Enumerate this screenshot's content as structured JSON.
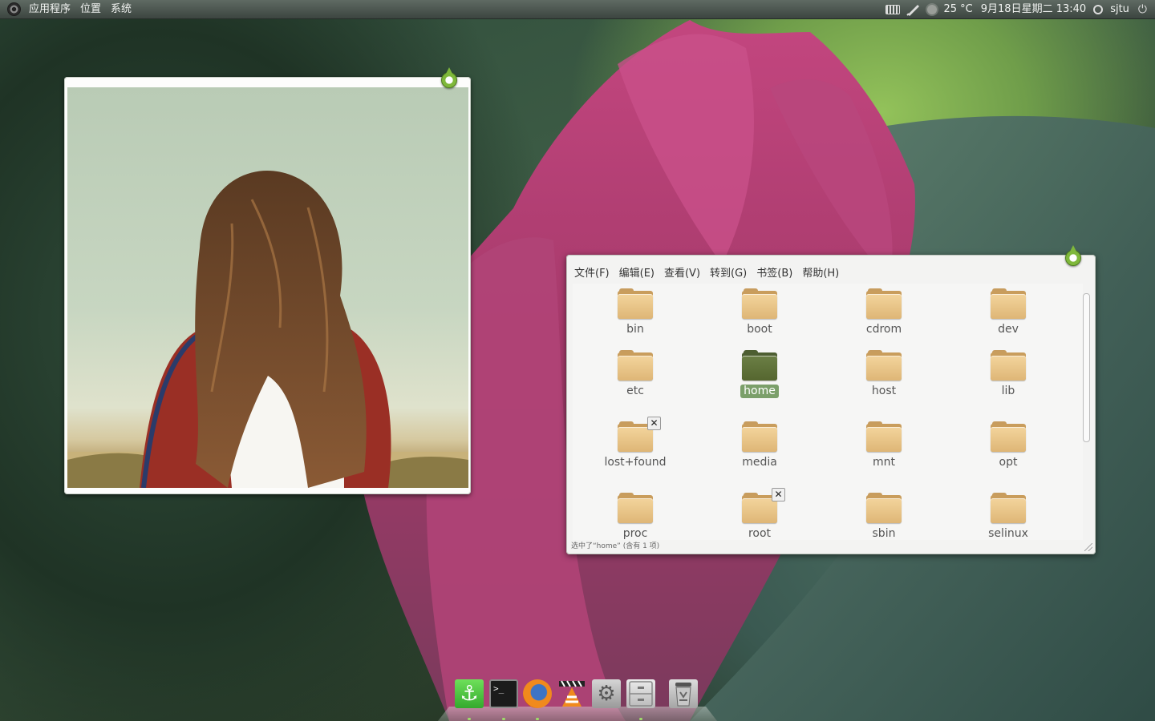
{
  "top_panel": {
    "menus": [
      "应用程序",
      "位置",
      "系统"
    ],
    "temperature": "25 °C",
    "datetime": "9月18日星期二 13:40",
    "username": "sjtu",
    "icons": [
      "ubuntu-logo-icon",
      "keyboard-icon",
      "network-icon",
      "weather-icon",
      "user-icon",
      "power-icon"
    ]
  },
  "photo_widget": {
    "icons": [
      "pin-icon"
    ]
  },
  "file_manager": {
    "menu": [
      "文件(F)",
      "编辑(E)",
      "查看(V)",
      "转到(G)",
      "书签(B)",
      "帮助(H)"
    ],
    "items": [
      {
        "label": "bin"
      },
      {
        "label": "boot"
      },
      {
        "label": "cdrom"
      },
      {
        "label": "dev"
      },
      {
        "label": "etc"
      },
      {
        "label": "home",
        "selected": true
      },
      {
        "label": "host"
      },
      {
        "label": "lib"
      },
      {
        "label": "lost+found",
        "emblem": "unreadable-x-icon"
      },
      {
        "label": "media"
      },
      {
        "label": "mnt"
      },
      {
        "label": "opt"
      },
      {
        "label": "proc"
      },
      {
        "label": "root",
        "emblem": "unreadable-x-icon"
      },
      {
        "label": "sbin"
      },
      {
        "label": "selinux"
      }
    ],
    "status": "选中了“home” (含有 1 项)"
  },
  "dock": {
    "items": [
      "anchor-icon",
      "terminal-icon",
      "firefox-icon",
      "vlc-icon",
      "settings-icon",
      "file-cabinet-icon",
      "trash-icon"
    ],
    "terminal_prompt": ">_"
  }
}
